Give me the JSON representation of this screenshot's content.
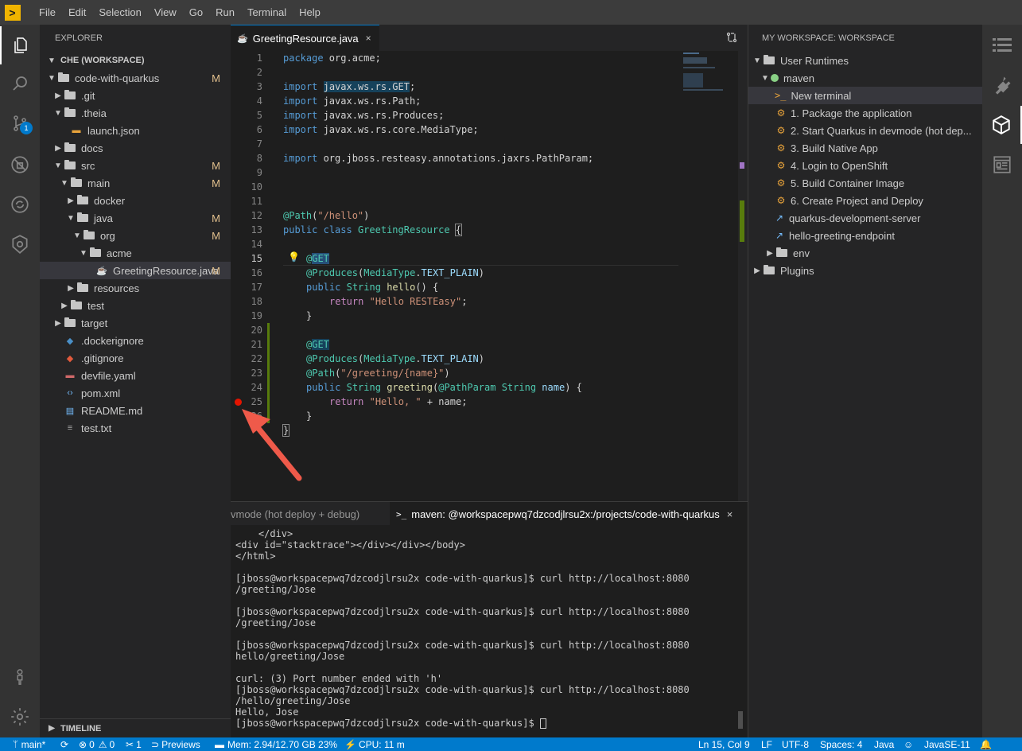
{
  "menubar": {
    "logo": ">",
    "items": [
      "File",
      "Edit",
      "Selection",
      "View",
      "Go",
      "Run",
      "Terminal",
      "Help"
    ]
  },
  "explorer": {
    "title": "EXPLORER",
    "section": "CHE (WORKSPACE)",
    "tree": [
      {
        "label": "code-with-quarkus",
        "depth": 0,
        "kind": "folder",
        "open": true,
        "mod": "M"
      },
      {
        "label": ".git",
        "depth": 1,
        "kind": "folder",
        "open": false,
        "mod": ""
      },
      {
        "label": ".theia",
        "depth": 1,
        "kind": "folder",
        "open": true,
        "mod": ""
      },
      {
        "label": "launch.json",
        "depth": 2,
        "kind": "json",
        "mod": ""
      },
      {
        "label": "docs",
        "depth": 1,
        "kind": "folder",
        "open": false,
        "mod": ""
      },
      {
        "label": "src",
        "depth": 1,
        "kind": "folder",
        "open": true,
        "mod": "M"
      },
      {
        "label": "main",
        "depth": 2,
        "kind": "folder",
        "open": true,
        "mod": "M"
      },
      {
        "label": "docker",
        "depth": 3,
        "kind": "folder",
        "open": false,
        "mod": ""
      },
      {
        "label": "java",
        "depth": 3,
        "kind": "folder",
        "open": true,
        "mod": "M"
      },
      {
        "label": "org",
        "depth": 4,
        "kind": "folder",
        "open": true,
        "mod": "M"
      },
      {
        "label": "acme",
        "depth": 5,
        "kind": "folder",
        "open": true,
        "mod": ""
      },
      {
        "label": "GreetingResource.java",
        "depth": 6,
        "kind": "java",
        "mod": "M",
        "selected": true
      },
      {
        "label": "resources",
        "depth": 3,
        "kind": "folder",
        "open": false,
        "mod": ""
      },
      {
        "label": "test",
        "depth": 2,
        "kind": "folder",
        "open": false,
        "mod": ""
      },
      {
        "label": "target",
        "depth": 1,
        "kind": "folder",
        "open": false,
        "mod": ""
      },
      {
        "label": ".dockerignore",
        "depth": 1,
        "kind": "docker",
        "mod": ""
      },
      {
        "label": ".gitignore",
        "depth": 1,
        "kind": "git",
        "mod": ""
      },
      {
        "label": "devfile.yaml",
        "depth": 1,
        "kind": "yaml",
        "mod": ""
      },
      {
        "label": "pom.xml",
        "depth": 1,
        "kind": "xml",
        "mod": ""
      },
      {
        "label": "README.md",
        "depth": 1,
        "kind": "md",
        "mod": ""
      },
      {
        "label": "test.txt",
        "depth": 1,
        "kind": "txt",
        "mod": ""
      }
    ],
    "timeline": "TIMELINE"
  },
  "editor": {
    "tab_label": "GreetingResource.java",
    "tab_close": "×",
    "lines": [
      "1",
      "2",
      "3",
      "4",
      "5",
      "6",
      "7",
      "8",
      "9",
      "10",
      "11",
      "12",
      "13",
      "14",
      "15",
      "16",
      "17",
      "18",
      "19",
      "20",
      "21",
      "22",
      "23",
      "24",
      "25",
      "26"
    ],
    "code": {
      "l1a": "package",
      "l1b": " org.acme;",
      "l3a": "import",
      "l3b": "javax.ws.rs.GET",
      "l3c": ";",
      "l4a": "import",
      "l4b": " javax.ws.rs.Path;",
      "l5a": "import",
      "l5b": " javax.ws.rs.Produces;",
      "l6a": "import",
      "l6b": " javax.ws.rs.core.MediaType;",
      "l8a": "import",
      "l8b": " org.jboss.resteasy.annotations.jaxrs.PathParam;",
      "l12a": "@Path",
      "l12b": "(",
      "l12c": "\"/hello\"",
      "l12d": ")",
      "l13a": "public",
      "l13b": "class",
      "l13c": "GreetingResource",
      "l13d": "{",
      "l15a": "@",
      "l15b": "GET",
      "l16a": "@Produces",
      "l16b": "(",
      "l16c": "MediaType",
      "l16d": ".",
      "l16e": "TEXT_PLAIN",
      "l16f": ")",
      "l17a": "public",
      "l17b": "String",
      "l17c": "hello",
      "l17d": "() {",
      "l18a": "return",
      "l18b": "\"Hello RESTEasy\"",
      "l18c": ";",
      "l19": "}",
      "l21a": "@",
      "l21b": "GET",
      "l22a": "@Produces",
      "l22b": "(",
      "l22c": "MediaType",
      "l22d": ".",
      "l22e": "TEXT_PLAIN",
      "l22f": ")",
      "l23a": "@Path",
      "l23b": "(",
      "l23c": "\"/greeting/{name}\"",
      "l23d": ")",
      "l24a": "public",
      "l24b": "String",
      "l24c": "greeting",
      "l24d": "(",
      "l24e": "@PathParam",
      "l24f": "String",
      "l24g": "name",
      "l24h": ") {",
      "l25a": "return",
      "l25b": "\"Hello, \"",
      "l25c": " + name;",
      "l26": "}",
      "l27": "}"
    },
    "current_line": "15"
  },
  "terminal": {
    "tab1": "vmode (hot deploy + debug)",
    "tab2_icon": ">_",
    "tab2": "maven: @workspacepwq7dzcodjlrsu2x:/projects/code-with-quarkus",
    "tab2_close": "×",
    "lines": [
      "    </div>",
      "<div id=\"stacktrace\"></div></div></body>",
      "</html>",
      "",
      "[jboss@workspacepwq7dzcodjlrsu2x code-with-quarkus]$ curl http://localhost:8080",
      "/greeting/Jose",
      "",
      "[jboss@workspacepwq7dzcodjlrsu2x code-with-quarkus]$ curl http://localhost:8080",
      "/greeting/Jose",
      "",
      "[jboss@workspacepwq7dzcodjlrsu2x code-with-quarkus]$ curl http://localhost:8080",
      "hello/greeting/Jose",
      "",
      "curl: (3) Port number ended with 'h'",
      "[jboss@workspacepwq7dzcodjlrsu2x code-with-quarkus]$ curl http://localhost:8080",
      "/hello/greeting/Jose",
      "Hello, Jose",
      "[jboss@workspacepwq7dzcodjlrsu2x code-with-quarkus]$ "
    ]
  },
  "workspace": {
    "title": "MY WORKSPACE: WORKSPACE",
    "user_runtimes": "User Runtimes",
    "maven": "maven",
    "new_terminal_icon": ">_",
    "new_terminal": "New terminal",
    "commands": [
      "1. Package the application",
      "2. Start Quarkus in devmode (hot dep...",
      "3. Build Native App",
      "4. Login to OpenShift",
      "5. Build Container Image",
      "6. Create Project and Deploy"
    ],
    "endpoints": [
      "quarkus-development-server",
      "hello-greeting-endpoint"
    ],
    "env": "env",
    "plugins": "Plugins"
  },
  "statusbar": {
    "branch": "main*",
    "errors": "0",
    "warnings": "0",
    "tools": "1",
    "previews": "Previews",
    "mem": "Mem: 2.94/12.70 GB 23%",
    "cpu": "CPU: 11 m",
    "position": "Ln 15, Col 9",
    "eol": "LF",
    "encoding": "UTF-8",
    "spaces": "Spaces: 4",
    "language": "Java",
    "jdk": "JavaSE-11"
  },
  "scm_badge": "1",
  "colors": {
    "accent": "#007acc",
    "modified": "#e2c08d",
    "breakpoint": "#e51400",
    "arrow": "#ef5a4a"
  }
}
